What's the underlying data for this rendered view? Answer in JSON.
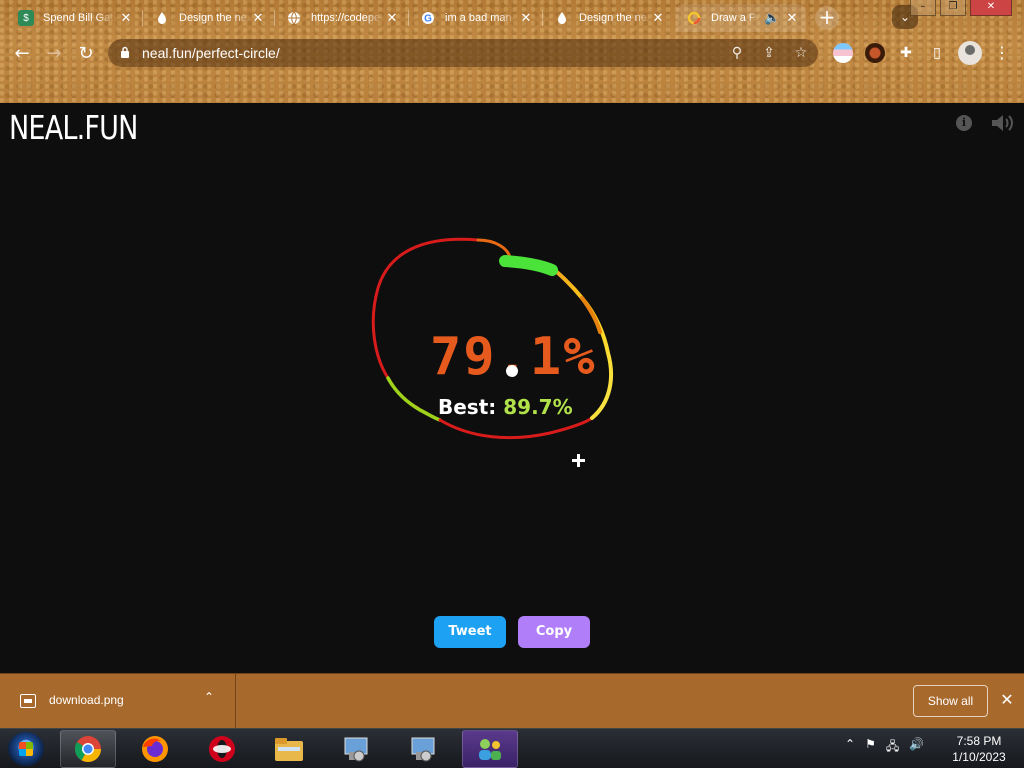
{
  "browser": {
    "tabs": [
      {
        "title": "Spend Bill Gates",
        "favicon": "money-icon",
        "color": "#2e8b57"
      },
      {
        "title": "Design the next",
        "favicon": "drop-icon",
        "color": "#ffffff"
      },
      {
        "title": "https://codepen",
        "favicon": "globe-icon",
        "color": "#ffffff"
      },
      {
        "title": "im a bad man",
        "favicon": "google-icon",
        "color": "#ffffff"
      },
      {
        "title": "Design the next",
        "favicon": "drop-icon",
        "color": "#ffffff"
      },
      {
        "title": "Draw a Perfect",
        "favicon": "circle-icon",
        "color": "#f4c430"
      }
    ],
    "new_tab_label": "+",
    "url": "neal.fun/perfect-circle/"
  },
  "page": {
    "logo": "NEAL.FUN",
    "score": "79.1%",
    "best_label": "Best:",
    "best_value": "89.7%",
    "buttons": {
      "tweet": "Tweet",
      "copy": "Copy"
    },
    "colors": {
      "score": "#e65a1e",
      "best": "#b2e24a",
      "tweet": "#1da1f2",
      "copy": "#b07ef8"
    }
  },
  "downloads": {
    "file_name": "download.png",
    "show_all": "Show all"
  },
  "taskbar": {
    "time": "7:58 PM",
    "date": "1/10/2023"
  }
}
